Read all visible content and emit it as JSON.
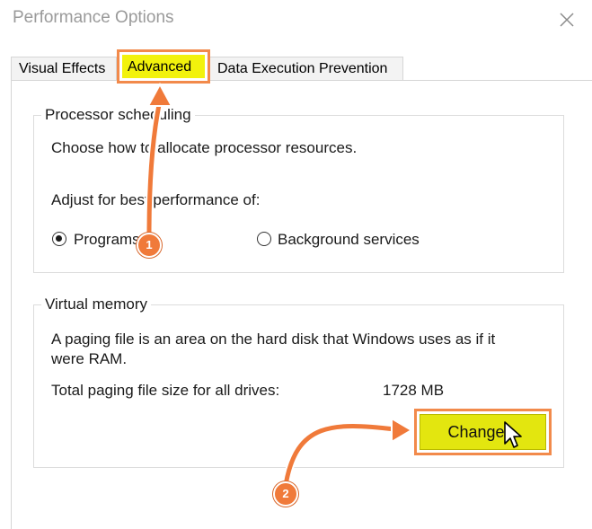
{
  "window": {
    "title": "Performance Options"
  },
  "tabs": [
    {
      "label": "Visual Effects"
    },
    {
      "label": "Advanced"
    },
    {
      "label": "Data Execution Prevention"
    }
  ],
  "processor_scheduling": {
    "group_title": "Processor scheduling",
    "description": "Choose how to allocate processor resources.",
    "adjust_label": "Adjust for best performance of:",
    "options": [
      {
        "label": "Programs",
        "selected": true
      },
      {
        "label": "Background services",
        "selected": false
      }
    ]
  },
  "virtual_memory": {
    "group_title": "Virtual memory",
    "description_line1": "A paging file is an area on the hard disk that Windows uses as if it",
    "description_line2": "were RAM.",
    "total_label": "Total paging file size for all drives:",
    "total_value": "1728 MB",
    "change_button": "Change..."
  },
  "annotations": [
    {
      "number": "1"
    },
    {
      "number": "2"
    }
  ],
  "colors": {
    "highlight_border": "#f28a4b",
    "highlight_fill": "#f2f20c",
    "badge": "#f07a3a"
  },
  "icons": {
    "close": "close-icon",
    "cursor": "mouse-pointer-icon"
  }
}
